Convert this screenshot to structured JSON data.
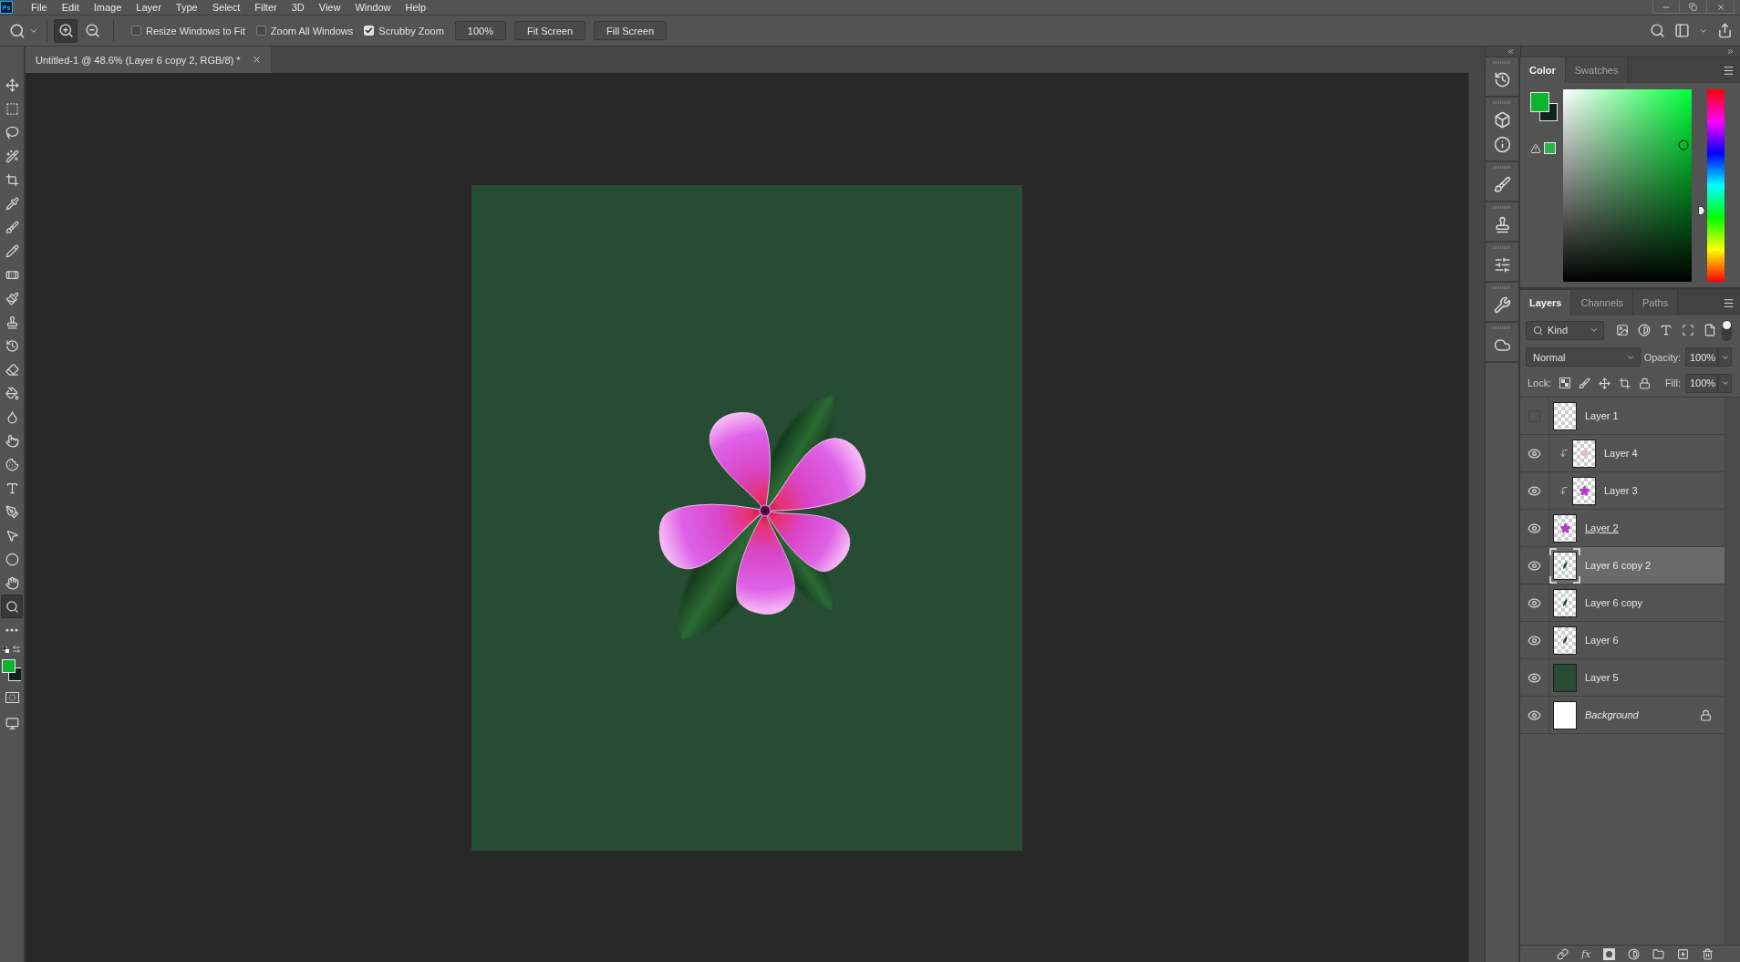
{
  "menu_bar": {
    "logo": "Ps",
    "items": [
      "File",
      "Edit",
      "Image",
      "Layer",
      "Type",
      "Select",
      "Filter",
      "3D",
      "View",
      "Window",
      "Help"
    ]
  },
  "options_bar": {
    "zoom_modes": [
      {
        "selected": true
      },
      {
        "selected": false
      }
    ],
    "checkboxes": [
      {
        "label": "Resize Windows to Fit",
        "checked": false
      },
      {
        "label": "Zoom All Windows",
        "checked": false
      },
      {
        "label": "Scrubby Zoom",
        "checked": true
      }
    ],
    "buttons": [
      "100%",
      "Fit Screen",
      "Fill Screen"
    ]
  },
  "toolbar": {
    "tools": [
      {
        "selected": false
      },
      {
        "selected": false
      },
      {
        "selected": false
      },
      {
        "selected": false
      },
      {
        "selected": false
      },
      {
        "selected": false
      },
      {
        "selected": false
      },
      {
        "selected": false
      },
      {
        "selected": false
      },
      {
        "selected": false
      },
      {
        "selected": false
      },
      {
        "selected": false
      },
      {
        "selected": false
      },
      {
        "selected": false
      },
      {
        "selected": false
      },
      {
        "selected": false
      },
      {
        "selected": false
      },
      {
        "selected": false
      },
      {
        "selected": false
      },
      {
        "selected": false
      },
      {
        "selected": false
      },
      {
        "selected": false
      },
      {
        "selected": true
      }
    ],
    "swatches": [
      {
        "color": "#0cb52d"
      },
      {
        "color": "#132020"
      }
    ]
  },
  "document": {
    "tab": "Untitled-1 @ 48.6% (Layer 6 copy 2, RGB/8) *"
  },
  "color_panel": {
    "tabs": [
      {
        "label": "Color",
        "selected": true
      },
      {
        "label": "Swatches",
        "selected": false
      }
    ],
    "swatches": [
      {
        "color": "#0cb52d"
      },
      {
        "color": "#132020"
      }
    ],
    "gamut_swatches": [
      {
        "color": "#2cb24a"
      }
    ],
    "hue_slider": {
      "level": 0.37
    }
  },
  "layers_panel": {
    "tabs": [
      {
        "label": "Layers",
        "selected": true
      },
      {
        "label": "Channels",
        "selected": false
      },
      {
        "label": "Paths",
        "selected": false
      }
    ],
    "filter_label": "Kind",
    "filter_enabled": true,
    "blend_mode": "Normal",
    "opacity_label": "Opacity:",
    "opacity": "100%",
    "lock_label": "Lock:",
    "fill_label": "Fill:",
    "fill": "100%",
    "layers": [
      {
        "name": "Layer 1",
        "kind": "empty",
        "visible": false,
        "clipped": false,
        "clip_base": false,
        "selected": false,
        "locked": false
      },
      {
        "name": "Layer 4",
        "kind": "spot",
        "visible": true,
        "clipped": true,
        "clip_base": false,
        "selected": false,
        "locked": false
      },
      {
        "name": "Layer 3",
        "kind": "flower",
        "visible": true,
        "clipped": true,
        "clip_base": false,
        "selected": false,
        "locked": false
      },
      {
        "name": "Layer 2",
        "kind": "flower",
        "visible": true,
        "clipped": false,
        "clip_base": true,
        "selected": false,
        "locked": false
      },
      {
        "name": "Layer 6 copy 2",
        "kind": "leaf",
        "visible": true,
        "clipped": false,
        "clip_base": false,
        "selected": true,
        "locked": false
      },
      {
        "name": "Layer 6 copy",
        "kind": "leaf",
        "visible": true,
        "clipped": false,
        "clip_base": false,
        "selected": false,
        "locked": false
      },
      {
        "name": "Layer 6",
        "kind": "leaf",
        "visible": true,
        "clipped": false,
        "clip_base": false,
        "selected": false,
        "locked": false
      },
      {
        "name": "Layer 5",
        "kind": "fill",
        "visible": true,
        "clipped": false,
        "clip_base": false,
        "selected": false,
        "locked": false
      },
      {
        "name": "Background",
        "kind": "background",
        "visible": true,
        "clipped": false,
        "clip_base": false,
        "selected": false,
        "locked": true
      }
    ],
    "footer_effects": "fx"
  }
}
